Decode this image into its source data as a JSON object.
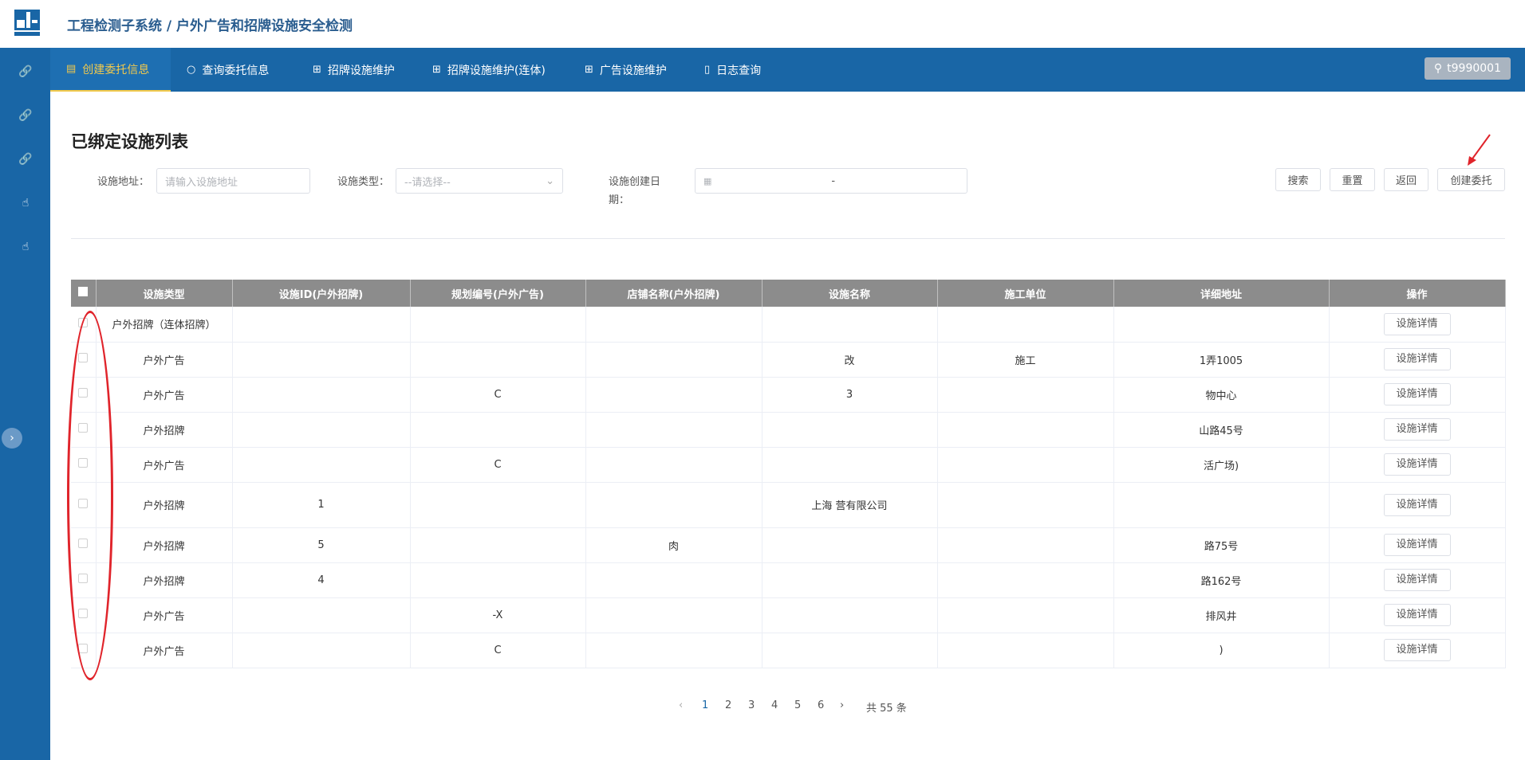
{
  "header": {
    "app_title": "工程检测子系统 / 户外广告和招牌设施安全检测"
  },
  "nav": {
    "items": [
      {
        "label": "创建委托信息",
        "icon": "document-icon",
        "active": true
      },
      {
        "label": "查询委托信息",
        "icon": "search-icon",
        "active": false
      },
      {
        "label": "招牌设施维护",
        "icon": "document-add-icon",
        "active": false
      },
      {
        "label": "招牌设施维护(连体)",
        "icon": "document-add-icon",
        "active": false
      },
      {
        "label": "广告设施维护",
        "icon": "document-add-icon",
        "active": false
      },
      {
        "label": "日志查询",
        "icon": "book-icon",
        "active": false
      }
    ],
    "user": "t9990001"
  },
  "page": {
    "title": "已绑定设施列表"
  },
  "filters": {
    "address_label": "设施地址：",
    "address_placeholder": "请输入设施地址",
    "type_label": "设施类型：",
    "type_placeholder": "--请选择--",
    "date_label_line1": "设施创建日",
    "date_label_line2": "期：",
    "date_separator": "-"
  },
  "buttons": {
    "search": "搜索",
    "reset": "重置",
    "back": "返回",
    "create": "创建委托"
  },
  "table": {
    "columns": [
      "设施类型",
      "设施ID(户外招牌)",
      "规划编号(户外广告)",
      "店铺名称(户外招牌)",
      "设施名称",
      "施工单位",
      "详细地址",
      "操作"
    ],
    "action_label": "设施详情",
    "rows": [
      {
        "type": "户外招牌（连体招牌）",
        "id": "",
        "plan": "",
        "shop": "",
        "name": "",
        "builder": "",
        "address": ""
      },
      {
        "type": "户外广告",
        "id": "",
        "plan": "",
        "shop": "",
        "name": "改",
        "builder": "施工",
        "address": "1弄1005"
      },
      {
        "type": "户外广告",
        "id": "",
        "plan": "C",
        "shop": "",
        "name": "3",
        "builder": "",
        "address": "物中心"
      },
      {
        "type": "户外招牌",
        "id": "",
        "plan": "",
        "shop": "",
        "name": "",
        "builder": "",
        "address": "山路45号"
      },
      {
        "type": "户外广告",
        "id": "",
        "plan": "C",
        "shop": "",
        "name": "",
        "builder": "",
        "address": "活广场)"
      },
      {
        "type": "户外招牌",
        "id": "1",
        "plan": "",
        "shop": "",
        "name": "上海 营有限公司",
        "builder": "",
        "address": ""
      },
      {
        "type": "户外招牌",
        "id": "5",
        "plan": "",
        "shop": "肉",
        "name": "",
        "builder": "",
        "address": "路75号"
      },
      {
        "type": "户外招牌",
        "id": "4",
        "plan": "",
        "shop": "",
        "name": "",
        "builder": "",
        "address": "路162号"
      },
      {
        "type": "户外广告",
        "id": "",
        "plan": "-X",
        "shop": "",
        "name": "",
        "builder": "",
        "address": "排风井"
      },
      {
        "type": "户外广告",
        "id": "",
        "plan": "C",
        "shop": "",
        "name": "",
        "builder": "",
        "address": ")"
      }
    ]
  },
  "pagination": {
    "pages": [
      "1",
      "2",
      "3",
      "4",
      "5",
      "6"
    ],
    "current": "1",
    "total_text": "共 55 条"
  },
  "colors": {
    "primary": "#1966a6",
    "active_tab": "#f2c94c",
    "annotation": "#e0242b"
  }
}
